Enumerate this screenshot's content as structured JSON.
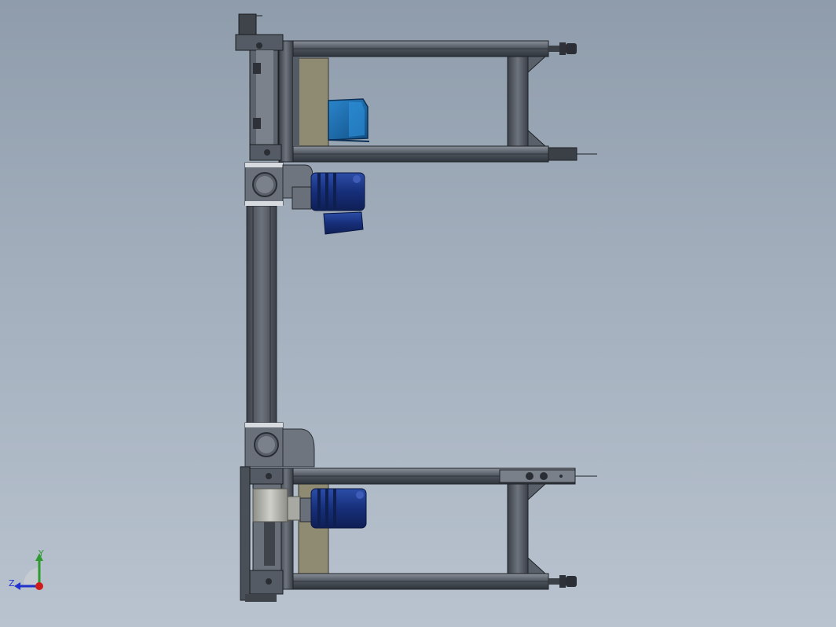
{
  "viewport": {
    "background_top": "#8f9cab",
    "background_bottom": "#b9c3cf"
  },
  "colors": {
    "frame_dark": "#4a4f58",
    "frame_mid": "#6d737d",
    "frame_light": "#9aa0a8",
    "motor_blue": "#1d3b8f",
    "motor_blue_light": "#3558b8",
    "guard_blue": "#1f6fb0",
    "plate_olive": "#8f8a72",
    "gear_gray": "#b8b8b2"
  },
  "triad": {
    "y_label": "Y",
    "z_label": "Z",
    "y_color": "#2f9a2f",
    "z_color": "#2233cc",
    "origin_color": "#d01b1b"
  },
  "parts": {
    "upper_frame": "upper-conveyor-frame",
    "lower_frame": "lower-conveyor-frame",
    "vertical_column": "vertical-column",
    "upper_motor": "upper-gear-motor",
    "lower_motor": "lower-gear-motor",
    "guard": "blue-safety-guard"
  }
}
